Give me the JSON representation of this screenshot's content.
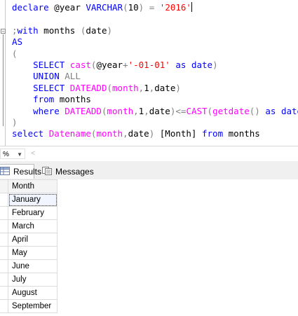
{
  "editor": {
    "line1": {
      "kw": "declare",
      "var": "@year",
      "type": "VARCHAR",
      "open": "(",
      "len": "10",
      "close": ")",
      "eq": "=",
      "str": "'2016'"
    },
    "line3": {
      "semi": ";",
      "kw": "with",
      "name": "months",
      "open": "(",
      "col": "date",
      "close": ")"
    },
    "line4": {
      "kw": "AS"
    },
    "line5": {
      "paren": "("
    },
    "line6": {
      "kw_select": "SELECT",
      "fn_cast": "cast",
      "open": "(",
      "var": "@year",
      "plus": "+",
      "str": "'-01-01'",
      "kw_as": "as",
      "kw_date": "date",
      "close": ")"
    },
    "line7": {
      "kw_union": "UNION",
      "kw_all": "ALL"
    },
    "line8": {
      "kw_select": "SELECT",
      "fn": "DATEADD",
      "open": "(",
      "arg1": "month",
      "c1": ",",
      "arg2": "1",
      "c2": ",",
      "arg3": "date",
      "close": ")"
    },
    "line9": {
      "kw_from": "from",
      "name": "months"
    },
    "line10": {
      "kw_where": "where",
      "fn": "DATEADD",
      "open": "(",
      "arg1": "month",
      "c1": ",",
      "arg2": "1",
      "c2": ",",
      "arg3": "date",
      "close": ")",
      "op": "<=",
      "fn_cast": "CAST",
      "open2": "(",
      "fn_getdate": "getdate",
      "parens": "()",
      "kw_as": "as",
      "kw_date": "date",
      "close2": ")"
    },
    "line11": {
      "paren": ")"
    },
    "line12": {
      "kw_select": "select",
      "fn": "Datename",
      "open": "(",
      "arg1": "month",
      "c1": ",",
      "arg2": "date",
      "close": ")",
      "alias": "[Month]",
      "kw_from": "from",
      "name": "months"
    }
  },
  "statusbar": {
    "zoom": "%",
    "zoom_arrow": "▼",
    "scroll_left": "<"
  },
  "tabs": [
    {
      "label": "Results",
      "icon": "grid-icon",
      "active": true
    },
    {
      "label": "Messages",
      "icon": "messages-icon",
      "active": false
    }
  ],
  "results": {
    "header": "Month",
    "rows": [
      "January",
      "February",
      "March",
      "April",
      "May",
      "June",
      "July",
      "August",
      "September"
    ],
    "selected_row": 0
  },
  "colors": {
    "keyword": "#0000ff",
    "function": "#ff00ff",
    "string": "#ff0000",
    "operator": "#808080"
  }
}
